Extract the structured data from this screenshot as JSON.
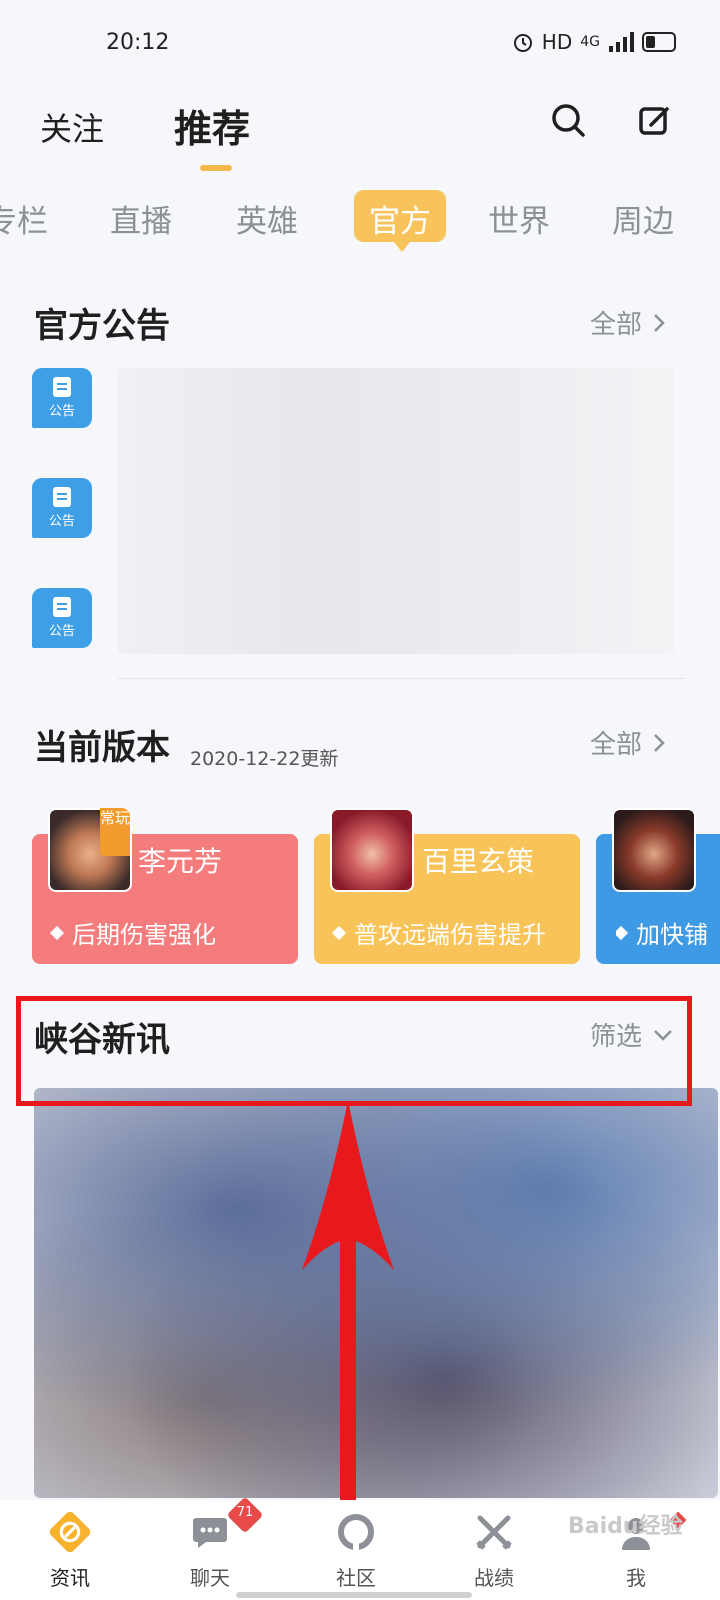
{
  "status": {
    "time": "20:12",
    "network": "HD",
    "signal": "4G"
  },
  "header": {
    "tabs": [
      {
        "label": "关注"
      },
      {
        "label": "推荐"
      }
    ],
    "search_icon": "search-icon",
    "edit_icon": "edit-icon"
  },
  "categories": [
    {
      "label": "专栏"
    },
    {
      "label": "直播"
    },
    {
      "label": "英雄"
    },
    {
      "label": "官方"
    },
    {
      "label": "世界"
    },
    {
      "label": "周边"
    }
  ],
  "announcements": {
    "title": "官方公告",
    "more": "全部",
    "items": [
      {
        "tag": "公告"
      },
      {
        "tag": "公告"
      },
      {
        "tag": "公告"
      }
    ]
  },
  "version": {
    "title": "当前版本",
    "date": "2020-12-22更新",
    "more": "全部",
    "heroes": [
      {
        "name": "李元芳",
        "desc": "后期伤害强化",
        "badge": "常玩",
        "color": "#f57c7c"
      },
      {
        "name": "百里玄策",
        "desc": "普攻远端伤害提升",
        "color": "#f8c459"
      },
      {
        "name": "",
        "desc": "加快铺",
        "color": "#3f9ae6"
      }
    ]
  },
  "news": {
    "title": "峡谷新讯",
    "filter": "筛选"
  },
  "bottom_nav": [
    {
      "label": "资讯",
      "icon": "news-icon"
    },
    {
      "label": "聊天",
      "icon": "chat-icon",
      "badge": "71"
    },
    {
      "label": "社区",
      "icon": "community-icon"
    },
    {
      "label": "战绩",
      "icon": "record-icon"
    },
    {
      "label": "我",
      "icon": "profile-icon"
    }
  ],
  "watermark": "Baidu经验"
}
